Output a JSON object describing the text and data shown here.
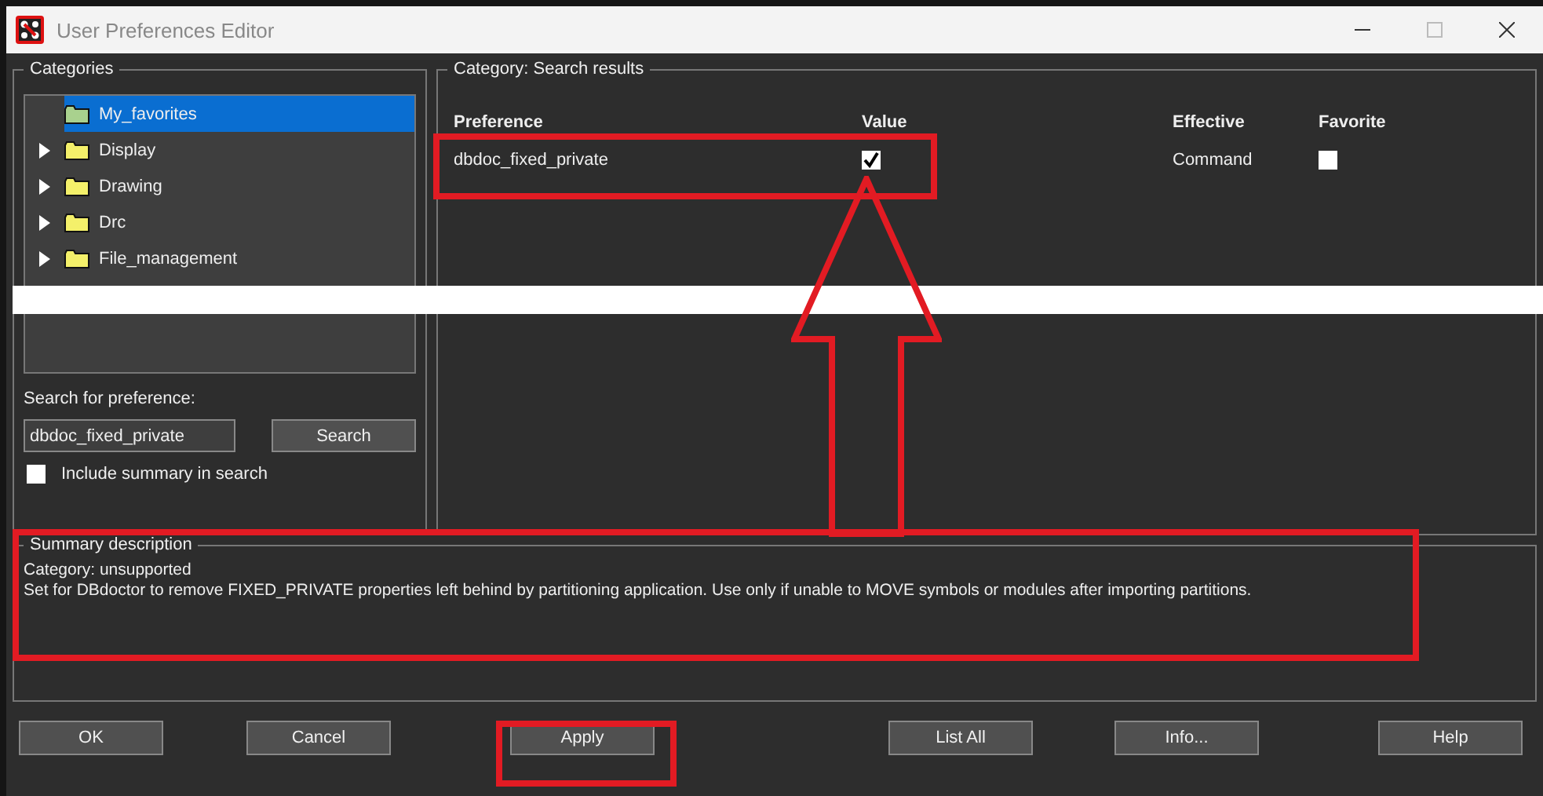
{
  "window": {
    "title": "User Preferences Editor"
  },
  "categories": {
    "title": "Categories",
    "items": [
      {
        "label": "My_favorites",
        "selected": true,
        "expandable": false,
        "kind": "favorites"
      },
      {
        "label": "Display",
        "selected": false,
        "expandable": true,
        "kind": "folder"
      },
      {
        "label": "Drawing",
        "selected": false,
        "expandable": true,
        "kind": "folder"
      },
      {
        "label": "Drc",
        "selected": false,
        "expandable": true,
        "kind": "folder"
      },
      {
        "label": "File_management",
        "selected": false,
        "expandable": true,
        "kind": "folder"
      }
    ]
  },
  "search": {
    "label": "Search for preference:",
    "value": "dbdoc_fixed_private",
    "button": "Search",
    "include_summary": {
      "label": "Include summary in search",
      "checked": false
    }
  },
  "results": {
    "category_label": "Category:",
    "category": "Search results",
    "columns": [
      "Preference",
      "Value",
      "Effective",
      "Favorite"
    ],
    "rows": [
      {
        "preference": "dbdoc_fixed_private",
        "value_checked": true,
        "effective": "Command",
        "favorite": false
      }
    ]
  },
  "summary": {
    "title": "Summary description",
    "lines": [
      "Category: unsupported",
      "Set for DBdoctor to remove FIXED_PRIVATE properties left behind by partitioning application. Use only if unable to MOVE symbols or modules after importing partitions."
    ]
  },
  "buttons": [
    "OK",
    "Cancel",
    "Apply",
    "List All",
    "Info...",
    "Help"
  ]
}
